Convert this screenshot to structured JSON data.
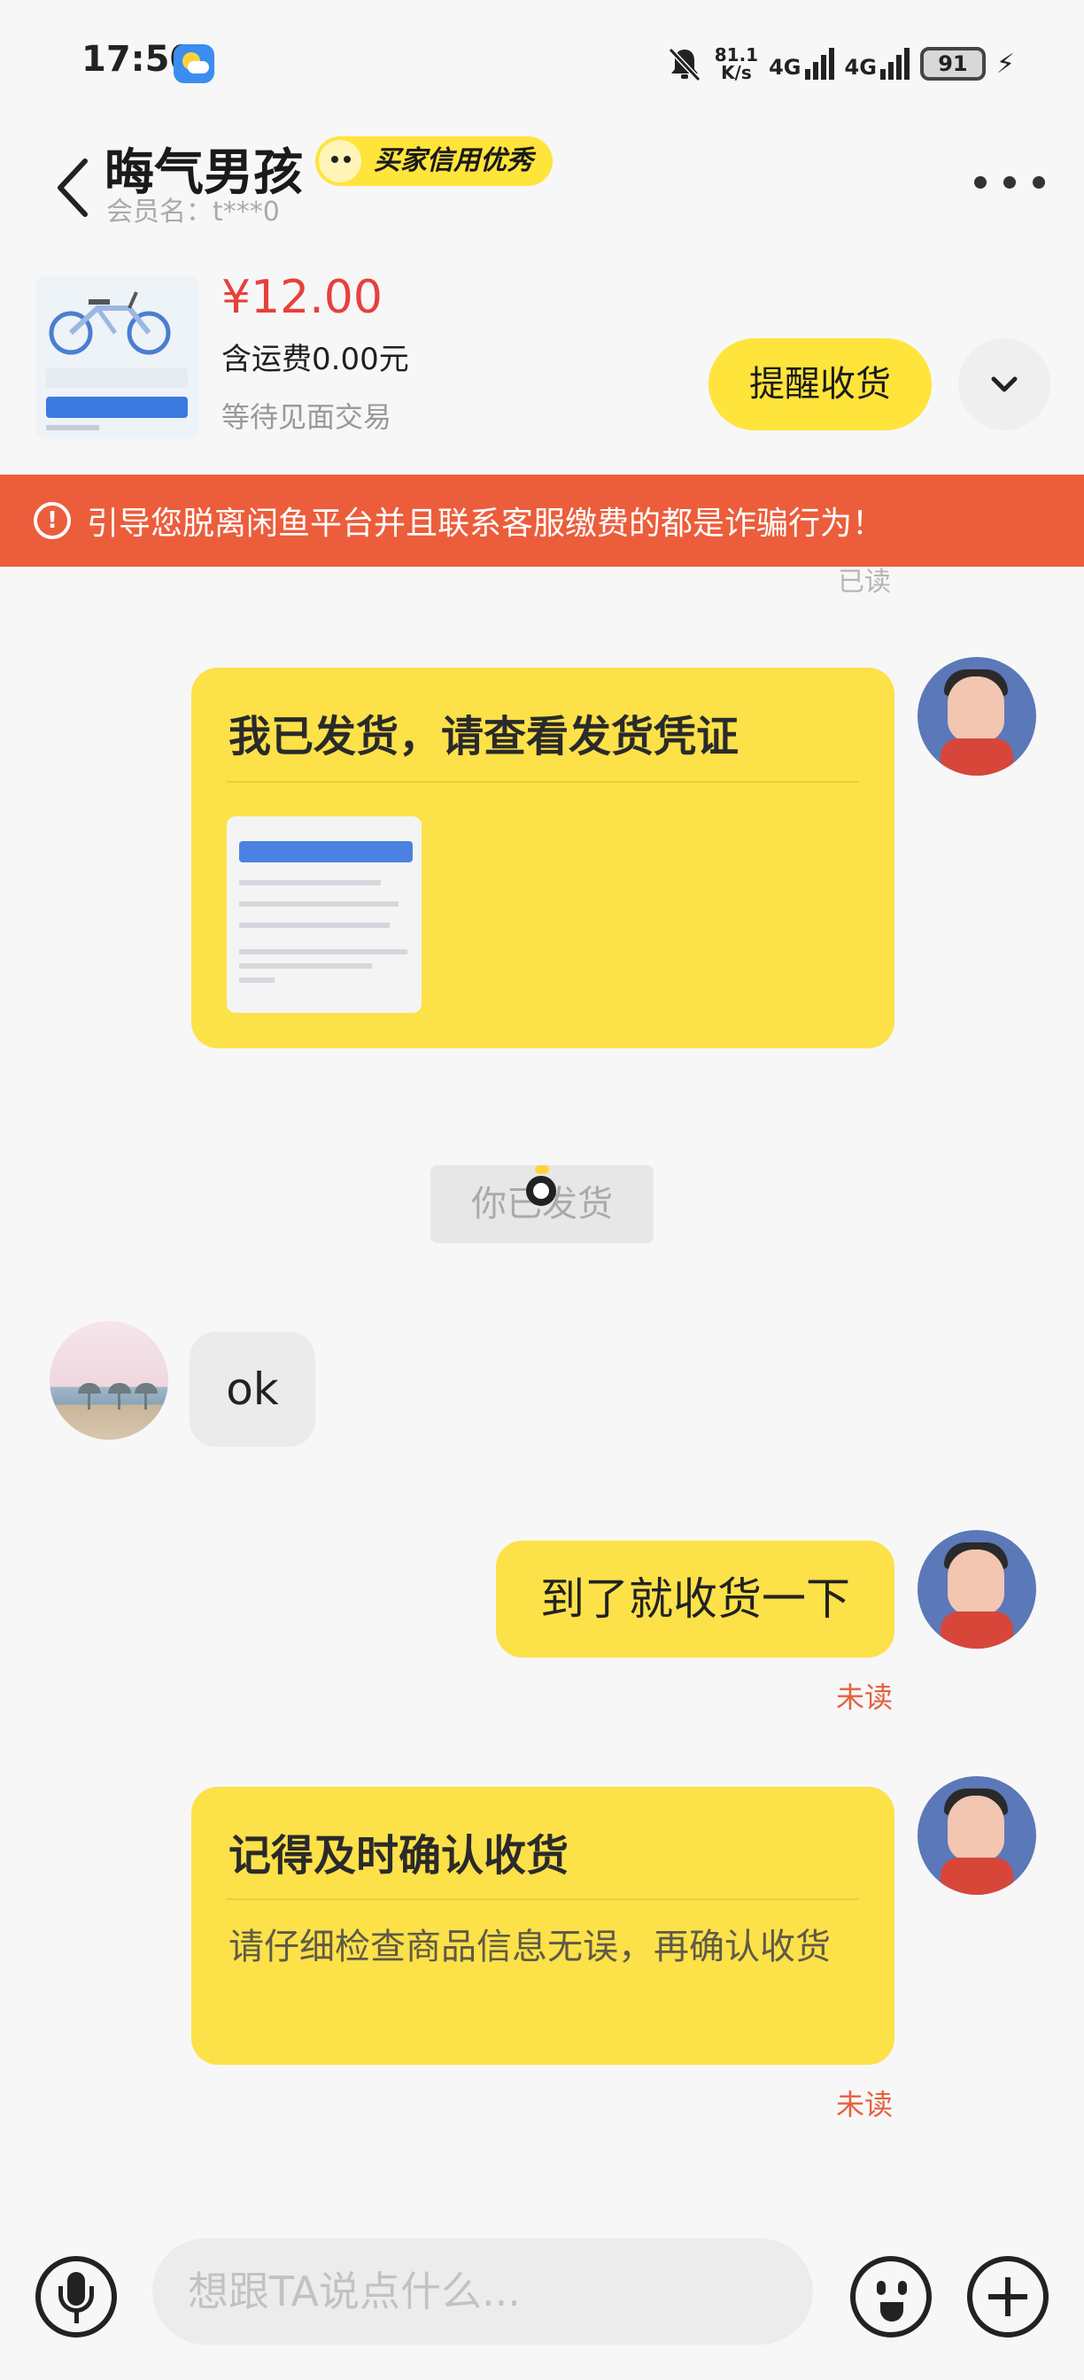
{
  "status_bar": {
    "time": "17:50",
    "net_speed_value": "81.1",
    "net_speed_unit": "K/s",
    "sim1": "4G",
    "sim2": "4G",
    "battery": "91"
  },
  "header": {
    "title": "晦气男孩",
    "credit_badge": "买家信用优秀",
    "member": "会员名：t***0"
  },
  "product": {
    "price": "¥12.00",
    "shipping": "含运费0.00元",
    "status": "等待见面交易",
    "remind_label": "提醒收货"
  },
  "warning": {
    "text": "引导您脱离闲鱼平台并且联系客服缴费的都是诈骗行为！"
  },
  "messages": {
    "read_top": "已读",
    "card1_title": "我已发货，请查看发货凭证",
    "system_text": "你已发货",
    "other_msg": "ok",
    "my_msg": "到了就收货一下",
    "unread1": "未读",
    "card2_title": "记得及时确认收货",
    "card2_body": "请仔细检查商品信息无误，再确认收货",
    "unread2": "未读"
  },
  "input": {
    "placeholder": "想跟TA说点什么..."
  },
  "colors": {
    "accent_yellow": "#fce149",
    "button_yellow": "#ffe43b",
    "warning_red": "#ec5d3b",
    "price_red": "#e8403b",
    "unread_orange": "#e4613f"
  }
}
